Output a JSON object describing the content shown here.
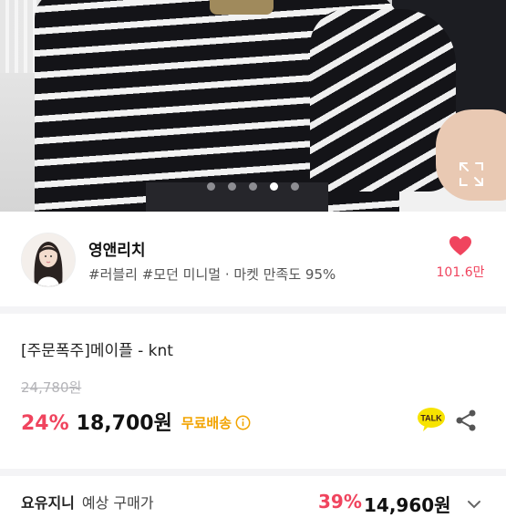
{
  "carousel": {
    "slide_count": 5,
    "active_index": 3
  },
  "shop": {
    "name": "영앤리치",
    "tags": "#러블리 #모던 미니멀 · 마켓 만족도 95%",
    "likes": "101.6만"
  },
  "product": {
    "name": "[주문폭주]메이플 - knt",
    "original_price": "24,780원",
    "discount": "24%",
    "price": "18,700원",
    "shipping": "무료배송"
  },
  "talk_button": {
    "label": "TALK"
  },
  "bottom_offer": {
    "label": "요유지니",
    "sub": "예상 구매가",
    "discount": "39%",
    "price": "14,960원"
  },
  "colors": {
    "accent_pink": "#f0445e",
    "shipping_yellow": "#f2a400",
    "talk_yellow": "#f7e300"
  },
  "icons": {
    "expand": "expand-icon",
    "heart": "heart-icon",
    "info": "info-icon",
    "share": "share-icon",
    "kakao_talk": "kakao-talk-icon",
    "chevron": "chevron-down-icon"
  }
}
